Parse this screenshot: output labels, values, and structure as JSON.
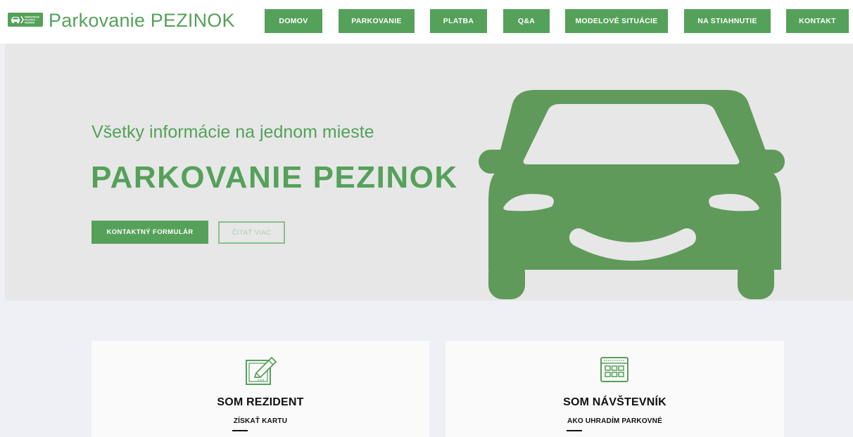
{
  "header": {
    "logo_icon": "car-logo-icon",
    "logo_text_lines": [
      "PARKOVACIA",
      "POLITIKA",
      "PEZINOK"
    ],
    "site_title": "Parkovanie PEZINOK"
  },
  "nav": {
    "items": [
      {
        "label": "DOMOV"
      },
      {
        "label": "PARKOVANIE"
      },
      {
        "label": "PLATBA"
      },
      {
        "label": "Q&A"
      },
      {
        "label": "MODELOVÉ SITUÁCIE"
      },
      {
        "label": "NA STIAHNUTIE"
      },
      {
        "label": "KONTAKT"
      }
    ]
  },
  "hero": {
    "tagline": "Všetky informácie na jednom mieste",
    "title": "PARKOVANIE PEZINOK",
    "primary_button": "KONTAKTNÝ FORMULÁR",
    "secondary_button": "ČÍTAŤ VIAC",
    "illustration": "smiling-car-icon"
  },
  "cards": [
    {
      "icon": "pencil-document-icon",
      "title": "SOM REZIDENT",
      "link": "ZÍSKAŤ KARTU"
    },
    {
      "icon": "calendar-icon",
      "title": "SOM NÁVŠTEVNÍK",
      "link": "AKO UHRADÍM PARKOVNÉ"
    }
  ],
  "colors": {
    "brand_green": "#55a15a",
    "car_green": "#5f9a5a",
    "hero_bg": "#e7e7e7",
    "page_bg": "#eff0f5",
    "card_bg": "#fafafa"
  }
}
